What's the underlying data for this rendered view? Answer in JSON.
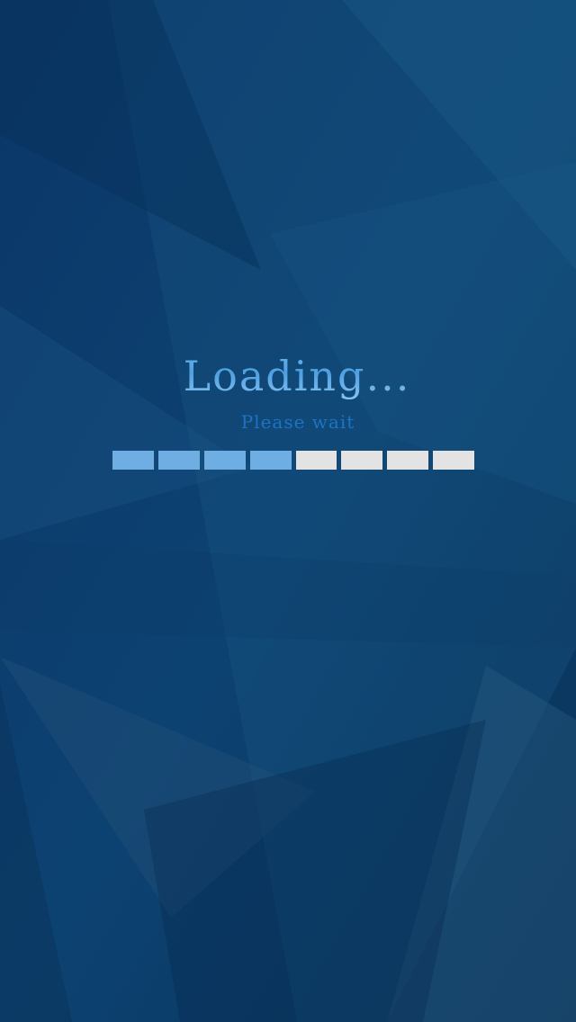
{
  "screen": {
    "title": "Loading...",
    "subtitle": "Please wait"
  },
  "progress": {
    "segments_total": 8,
    "segments_filled": 4,
    "fraction": 0.5
  },
  "colors": {
    "background": "#0a3a66",
    "title": "#5aaae8",
    "subtitle": "#1d74c4",
    "segment_filled": "#6eaee3",
    "segment_empty": "#e3e3e3"
  }
}
